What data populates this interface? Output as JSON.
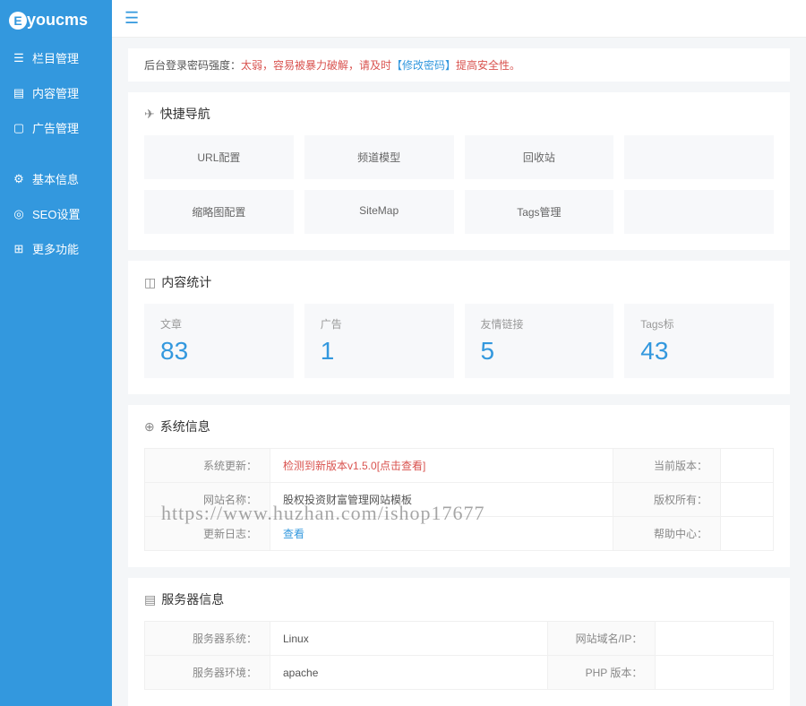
{
  "logo": {
    "prefix": "E",
    "text": "youcms"
  },
  "sidebar": {
    "items": [
      {
        "label": "栏目管理"
      },
      {
        "label": "内容管理"
      },
      {
        "label": "广告管理"
      },
      {
        "label": "基本信息"
      },
      {
        "label": "SEO设置"
      },
      {
        "label": "更多功能"
      }
    ]
  },
  "alert": {
    "prefix": "后台登录密码强度：",
    "danger": "太弱，容易被暴力破解，请及时",
    "link": "【修改密码】",
    "suffix": "提高安全性。"
  },
  "quicknav": {
    "title": "快捷导航",
    "items": [
      "URL配置",
      "频道模型",
      "回收站",
      "",
      "缩略图配置",
      "SiteMap",
      "Tags管理",
      ""
    ]
  },
  "stats": {
    "title": "内容统计",
    "cards": [
      {
        "label": "文章",
        "value": "83"
      },
      {
        "label": "广告",
        "value": "1"
      },
      {
        "label": "友情链接",
        "value": "5"
      },
      {
        "label": "Tags标",
        "value": "43"
      }
    ]
  },
  "sysinfo": {
    "title": "系统信息",
    "rows": [
      {
        "l1": "系统更新：",
        "v1": "检测到新版本v1.5.0[点击查看]",
        "v1_red": true,
        "l2": "当前版本：",
        "v2": ""
      },
      {
        "l1": "网站名称：",
        "v1": "股权投资财富管理网站模板",
        "l2": "版权所有：",
        "v2": ""
      },
      {
        "l1": "更新日志：",
        "v1": "查看",
        "v1_blue": true,
        "l2": "帮助中心：",
        "v2": ""
      }
    ]
  },
  "serverinfo": {
    "title": "服务器信息",
    "rows": [
      {
        "l1": "服务器系统：",
        "v1": "Linux",
        "l2": "网站域名/IP：",
        "v2": ""
      },
      {
        "l1": "服务器环境：",
        "v1": "apache",
        "l2": "PHP 版本：",
        "v2": ""
      }
    ]
  },
  "watermark": "https://www.huzhan.com/ishop17677"
}
